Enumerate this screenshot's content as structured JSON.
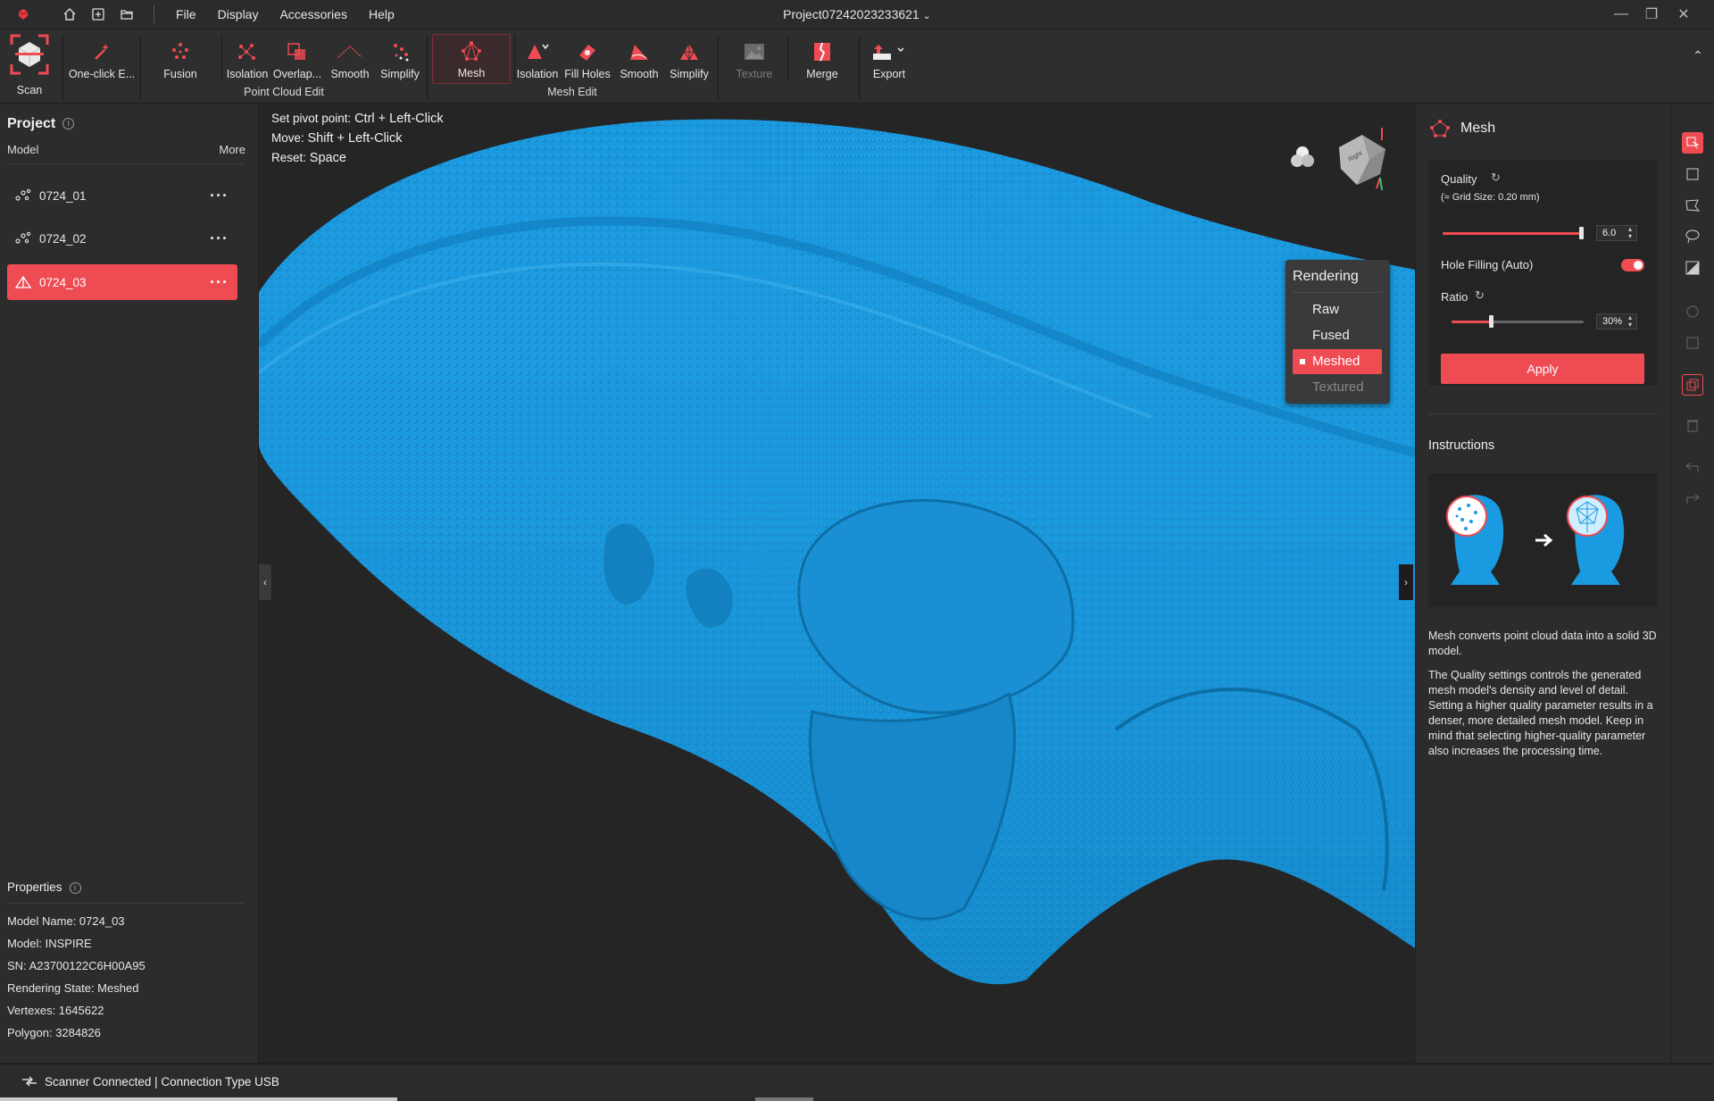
{
  "titlebar": {
    "menus": [
      "File",
      "Display",
      "Accessories",
      "Help"
    ],
    "project_title": "Project07242023233621",
    "icons": [
      "app-logo-icon",
      "home-icon",
      "new-project-icon",
      "open-folder-icon"
    ]
  },
  "ribbon": {
    "scan": "Scan",
    "one_click": "One-click E...",
    "point_cloud": {
      "group": "Point Cloud Edit",
      "fusion": "Fusion",
      "isolation": "Isolation",
      "overlap": "Overlap...",
      "smooth": "Smooth",
      "simplify": "Simplify"
    },
    "mesh_edit": {
      "group": "Mesh Edit",
      "mesh": "Mesh",
      "isolation": "Isolation",
      "fill_holes": "Fill Holes",
      "smooth": "Smooth",
      "simplify": "Simplify"
    },
    "texture": "Texture",
    "merge": "Merge",
    "export": "Export"
  },
  "project": {
    "title": "Project",
    "model_header": "Model",
    "more": "More",
    "models": [
      {
        "name": "0724_01",
        "icon": "point-cloud-icon",
        "active": false
      },
      {
        "name": "0724_02",
        "icon": "point-cloud-icon",
        "active": false
      },
      {
        "name": "0724_03",
        "icon": "mesh-icon",
        "active": true
      }
    ]
  },
  "properties": {
    "title": "Properties",
    "lines": [
      "Model Name:  0724_03",
      "Model:  INSPIRE",
      "SN:  A23700122C6H00A95",
      "Rendering State:  Meshed",
      "Vertexes:  1645622",
      "Polygon:  3284826"
    ]
  },
  "viewport": {
    "hints": [
      {
        "label": "Set pivot point: ",
        "key": "Ctrl + Left-Click"
      },
      {
        "label": "Move: ",
        "key": "Shift + Left-Click"
      },
      {
        "label": "Reset: ",
        "key": "Space"
      }
    ],
    "mesh_color": "#1a9ae0",
    "rendering": {
      "title": "Rendering",
      "options": [
        "Raw",
        "Fused",
        "Meshed",
        "Textured"
      ],
      "selected": "Meshed",
      "disabled": "Textured"
    }
  },
  "mesh_panel": {
    "title": "Mesh",
    "quality_label": "Quality",
    "grid_size": "(≈ Grid Size: 0.20 mm)",
    "quality_value": "6.0",
    "quality_fraction": 0.98,
    "hole_filling_label": "Hole Filling (Auto)",
    "hole_filling_on": true,
    "ratio_label": "Ratio",
    "ratio_value": "30%",
    "ratio_fraction": 0.3,
    "apply": "Apply",
    "instructions_title": "Instructions",
    "instructions_p1": "Mesh converts point cloud data into a solid 3D model.",
    "instructions_p2": "The Quality settings controls the generated mesh model's density and level of detail. Setting a higher quality parameter results in a denser, more detailed mesh model. Keep in mind that selecting higher-quality parameter also increases the processing time."
  },
  "status": {
    "text": "Scanner Connected | Connection Type USB"
  },
  "colors": {
    "accent": "#ef4b53",
    "panel": "#2c2c2c",
    "background": "#252525"
  }
}
